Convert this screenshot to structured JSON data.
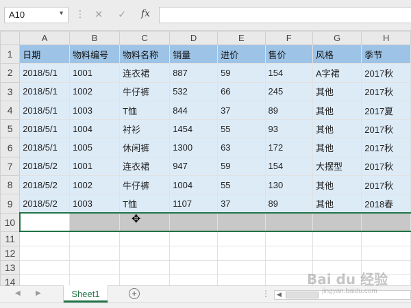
{
  "formula_bar": {
    "name_box": "A10",
    "cancel_glyph": "✕",
    "confirm_glyph": "✓",
    "fx_label": "fx",
    "formula_value": ""
  },
  "columns": [
    "A",
    "B",
    "C",
    "D",
    "E",
    "F",
    "G",
    "H"
  ],
  "rows": [
    {
      "num": "1",
      "cells": [
        "日期",
        "物料编号",
        "物料名称",
        "销量",
        "进价",
        "售价",
        "风格",
        "季节"
      ]
    },
    {
      "num": "2",
      "cells": [
        "2018/5/1",
        "1001",
        "连衣裙",
        "887",
        "59",
        "154",
        "A字裙",
        "2017秋"
      ]
    },
    {
      "num": "3",
      "cells": [
        "2018/5/1",
        "1002",
        "牛仔裤",
        "532",
        "66",
        "245",
        "其他",
        "2017秋"
      ]
    },
    {
      "num": "4",
      "cells": [
        "2018/5/1",
        "1003",
        "T恤",
        "844",
        "37",
        "89",
        "其他",
        "2017夏"
      ]
    },
    {
      "num": "5",
      "cells": [
        "2018/5/1",
        "1004",
        "衬衫",
        "1454",
        "55",
        "93",
        "其他",
        "2017秋"
      ]
    },
    {
      "num": "6",
      "cells": [
        "2018/5/1",
        "1005",
        "休闲裤",
        "1300",
        "63",
        "172",
        "其他",
        "2017秋"
      ]
    },
    {
      "num": "7",
      "cells": [
        "2018/5/2",
        "1001",
        "连衣裙",
        "947",
        "59",
        "154",
        "大摆型",
        "2017秋"
      ]
    },
    {
      "num": "8",
      "cells": [
        "2018/5/2",
        "1002",
        "牛仔裤",
        "1004",
        "55",
        "130",
        "其他",
        "2017秋"
      ]
    },
    {
      "num": "9",
      "cells": [
        "2018/5/2",
        "1003",
        "T恤",
        "1107",
        "37",
        "89",
        "其他",
        "2018春"
      ]
    },
    {
      "num": "10",
      "cells": [
        "",
        "",
        "",
        "",
        "",
        "",
        "",
        ""
      ]
    },
    {
      "num": "11",
      "cells": [
        "",
        "",
        "",
        "",
        "",
        "",
        "",
        ""
      ]
    },
    {
      "num": "12",
      "cells": [
        "",
        "",
        "",
        "",
        "",
        "",
        "",
        ""
      ]
    },
    {
      "num": "13",
      "cells": [
        "",
        "",
        "",
        "",
        "",
        "",
        "",
        ""
      ]
    },
    {
      "num": "14",
      "cells": [
        "",
        "",
        "",
        "",
        "",
        "",
        "",
        ""
      ]
    }
  ],
  "sheet_tabs": [
    {
      "label": "Sheet1",
      "active": true
    }
  ],
  "add_sheet_glyph": "+",
  "watermark": {
    "main": "Bai du 经验",
    "sub": "jingyan.baidu.com"
  },
  "colors": {
    "header_row": "#9dc3e6",
    "data_row": "#ddebf7",
    "accent": "#217346"
  }
}
